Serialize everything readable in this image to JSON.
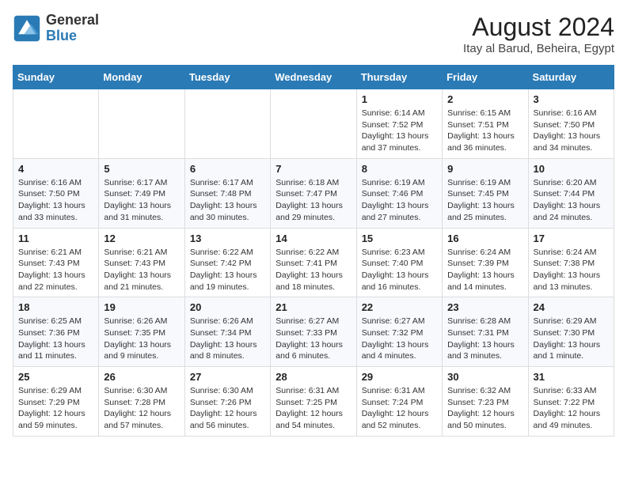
{
  "header": {
    "logo_general": "General",
    "logo_blue": "Blue",
    "month_year": "August 2024",
    "location": "Itay al Barud, Beheira, Egypt"
  },
  "days_of_week": [
    "Sunday",
    "Monday",
    "Tuesday",
    "Wednesday",
    "Thursday",
    "Friday",
    "Saturday"
  ],
  "weeks": [
    [
      {
        "day": "",
        "info": ""
      },
      {
        "day": "",
        "info": ""
      },
      {
        "day": "",
        "info": ""
      },
      {
        "day": "",
        "info": ""
      },
      {
        "day": "1",
        "info": "Sunrise: 6:14 AM\nSunset: 7:52 PM\nDaylight: 13 hours and 37 minutes."
      },
      {
        "day": "2",
        "info": "Sunrise: 6:15 AM\nSunset: 7:51 PM\nDaylight: 13 hours and 36 minutes."
      },
      {
        "day": "3",
        "info": "Sunrise: 6:16 AM\nSunset: 7:50 PM\nDaylight: 13 hours and 34 minutes."
      }
    ],
    [
      {
        "day": "4",
        "info": "Sunrise: 6:16 AM\nSunset: 7:50 PM\nDaylight: 13 hours and 33 minutes."
      },
      {
        "day": "5",
        "info": "Sunrise: 6:17 AM\nSunset: 7:49 PM\nDaylight: 13 hours and 31 minutes."
      },
      {
        "day": "6",
        "info": "Sunrise: 6:17 AM\nSunset: 7:48 PM\nDaylight: 13 hours and 30 minutes."
      },
      {
        "day": "7",
        "info": "Sunrise: 6:18 AM\nSunset: 7:47 PM\nDaylight: 13 hours and 29 minutes."
      },
      {
        "day": "8",
        "info": "Sunrise: 6:19 AM\nSunset: 7:46 PM\nDaylight: 13 hours and 27 minutes."
      },
      {
        "day": "9",
        "info": "Sunrise: 6:19 AM\nSunset: 7:45 PM\nDaylight: 13 hours and 25 minutes."
      },
      {
        "day": "10",
        "info": "Sunrise: 6:20 AM\nSunset: 7:44 PM\nDaylight: 13 hours and 24 minutes."
      }
    ],
    [
      {
        "day": "11",
        "info": "Sunrise: 6:21 AM\nSunset: 7:43 PM\nDaylight: 13 hours and 22 minutes."
      },
      {
        "day": "12",
        "info": "Sunrise: 6:21 AM\nSunset: 7:43 PM\nDaylight: 13 hours and 21 minutes."
      },
      {
        "day": "13",
        "info": "Sunrise: 6:22 AM\nSunset: 7:42 PM\nDaylight: 13 hours and 19 minutes."
      },
      {
        "day": "14",
        "info": "Sunrise: 6:22 AM\nSunset: 7:41 PM\nDaylight: 13 hours and 18 minutes."
      },
      {
        "day": "15",
        "info": "Sunrise: 6:23 AM\nSunset: 7:40 PM\nDaylight: 13 hours and 16 minutes."
      },
      {
        "day": "16",
        "info": "Sunrise: 6:24 AM\nSunset: 7:39 PM\nDaylight: 13 hours and 14 minutes."
      },
      {
        "day": "17",
        "info": "Sunrise: 6:24 AM\nSunset: 7:38 PM\nDaylight: 13 hours and 13 minutes."
      }
    ],
    [
      {
        "day": "18",
        "info": "Sunrise: 6:25 AM\nSunset: 7:36 PM\nDaylight: 13 hours and 11 minutes."
      },
      {
        "day": "19",
        "info": "Sunrise: 6:26 AM\nSunset: 7:35 PM\nDaylight: 13 hours and 9 minutes."
      },
      {
        "day": "20",
        "info": "Sunrise: 6:26 AM\nSunset: 7:34 PM\nDaylight: 13 hours and 8 minutes."
      },
      {
        "day": "21",
        "info": "Sunrise: 6:27 AM\nSunset: 7:33 PM\nDaylight: 13 hours and 6 minutes."
      },
      {
        "day": "22",
        "info": "Sunrise: 6:27 AM\nSunset: 7:32 PM\nDaylight: 13 hours and 4 minutes."
      },
      {
        "day": "23",
        "info": "Sunrise: 6:28 AM\nSunset: 7:31 PM\nDaylight: 13 hours and 3 minutes."
      },
      {
        "day": "24",
        "info": "Sunrise: 6:29 AM\nSunset: 7:30 PM\nDaylight: 13 hours and 1 minute."
      }
    ],
    [
      {
        "day": "25",
        "info": "Sunrise: 6:29 AM\nSunset: 7:29 PM\nDaylight: 12 hours and 59 minutes."
      },
      {
        "day": "26",
        "info": "Sunrise: 6:30 AM\nSunset: 7:28 PM\nDaylight: 12 hours and 57 minutes."
      },
      {
        "day": "27",
        "info": "Sunrise: 6:30 AM\nSunset: 7:26 PM\nDaylight: 12 hours and 56 minutes."
      },
      {
        "day": "28",
        "info": "Sunrise: 6:31 AM\nSunset: 7:25 PM\nDaylight: 12 hours and 54 minutes."
      },
      {
        "day": "29",
        "info": "Sunrise: 6:31 AM\nSunset: 7:24 PM\nDaylight: 12 hours and 52 minutes."
      },
      {
        "day": "30",
        "info": "Sunrise: 6:32 AM\nSunset: 7:23 PM\nDaylight: 12 hours and 50 minutes."
      },
      {
        "day": "31",
        "info": "Sunrise: 6:33 AM\nSunset: 7:22 PM\nDaylight: 12 hours and 49 minutes."
      }
    ]
  ]
}
